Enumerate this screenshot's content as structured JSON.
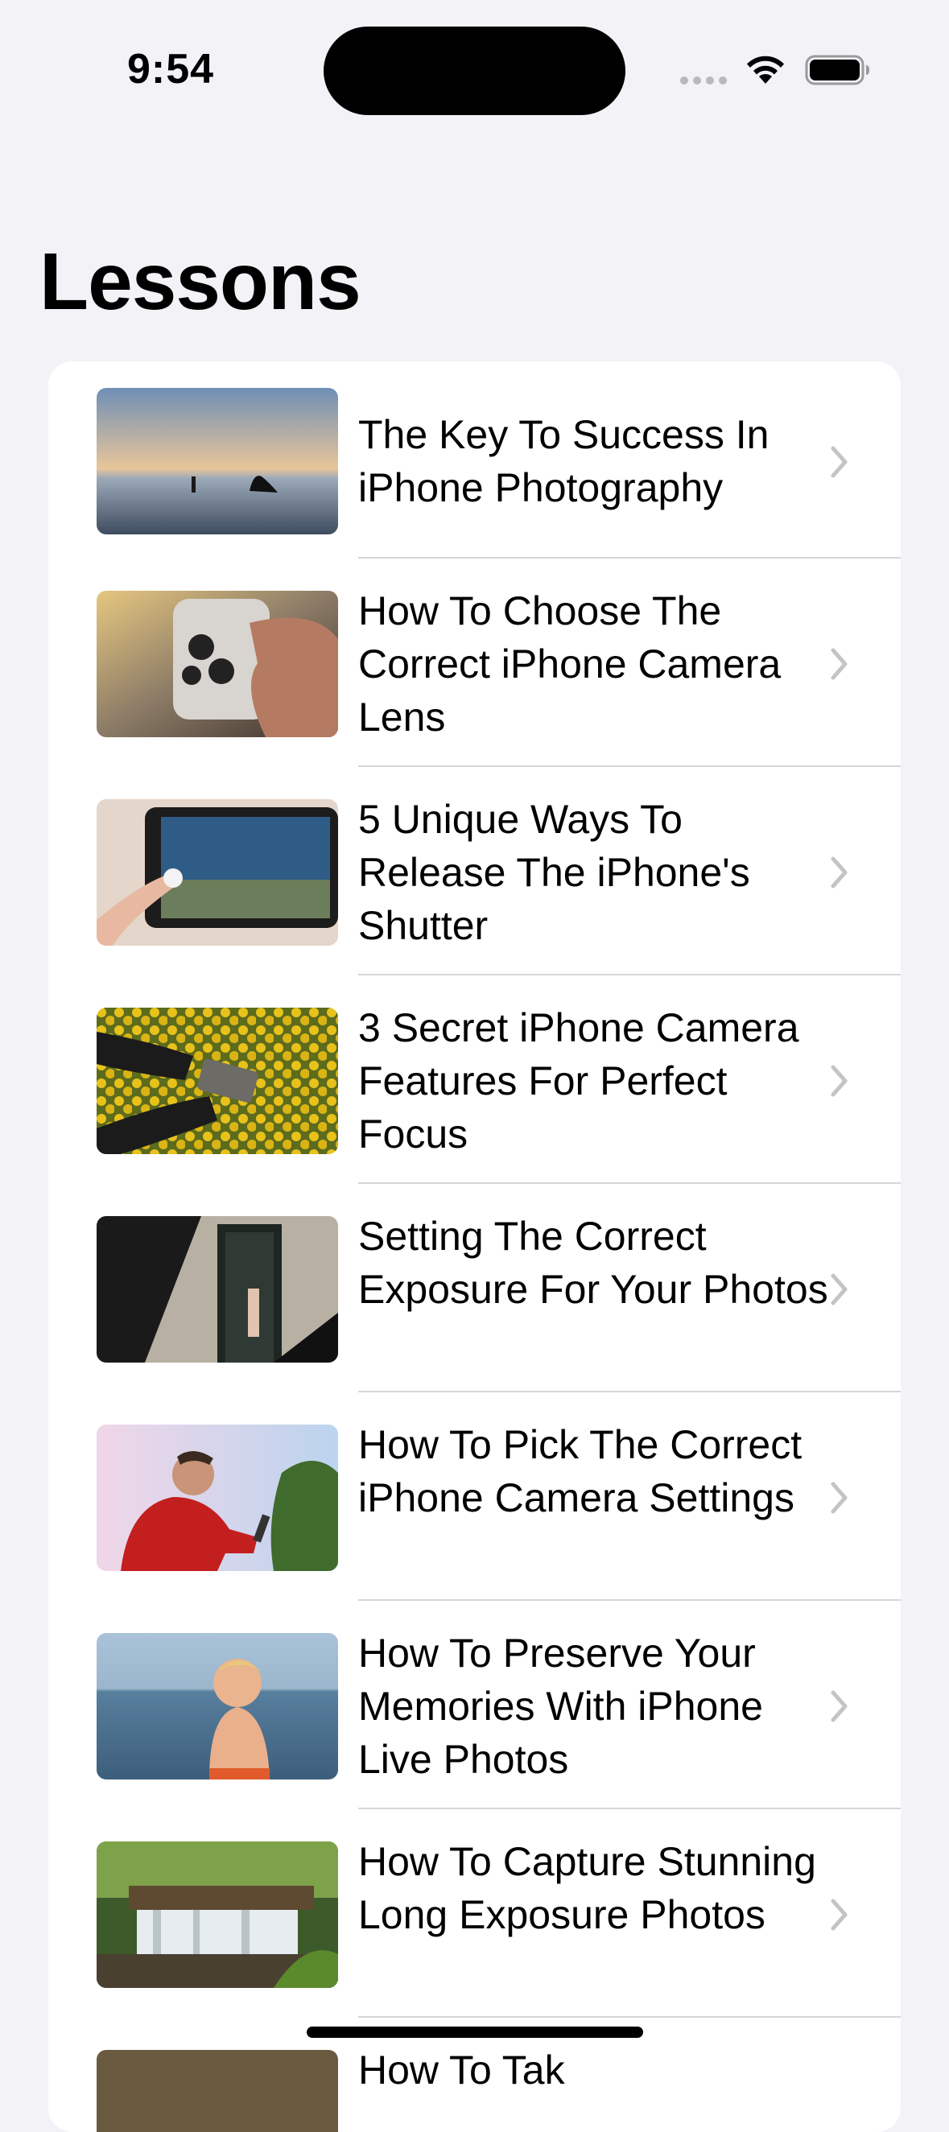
{
  "status_bar": {
    "time": "9:54"
  },
  "header": {
    "title": "Lessons"
  },
  "lessons": [
    {
      "title": "The Key To Success In iPhone Photography",
      "thumbnail": "beach-sunset-photographers"
    },
    {
      "title": "How To Choose The Correct iPhone Camera Lens",
      "thumbnail": "hand-holding-iphone-lenses"
    },
    {
      "title": "5 Unique Ways To Release The iPhone's Shutter",
      "thumbnail": "finger-pressing-shutter"
    },
    {
      "title": "3 Secret iPhone Camera Features For Perfect Focus",
      "thumbnail": "phone-over-yellow-flowers"
    },
    {
      "title": "Setting The Correct Exposure For Your Photos",
      "thumbnail": "woman-in-doorway-shadow"
    },
    {
      "title": "How To Pick The Correct iPhone Camera Settings",
      "thumbnail": "man-in-red-jacket-with-phone"
    },
    {
      "title": "How To Preserve Your Memories With iPhone Live Photos",
      "thumbnail": "baby-at-sea"
    },
    {
      "title": "How To Capture Stunning Long Exposure Photos",
      "thumbnail": "forest-waterfall"
    },
    {
      "title": "How To Tak",
      "thumbnail": "partially-visible"
    }
  ],
  "icons": {
    "row_chevron": "chevron-right-icon",
    "wifi": "wifi-icon",
    "battery": "battery-icon"
  },
  "colors": {
    "background": "#f2f2f7",
    "card": "#ffffff",
    "chevron": "#c4c4c7",
    "divider": "#d6d6da"
  }
}
